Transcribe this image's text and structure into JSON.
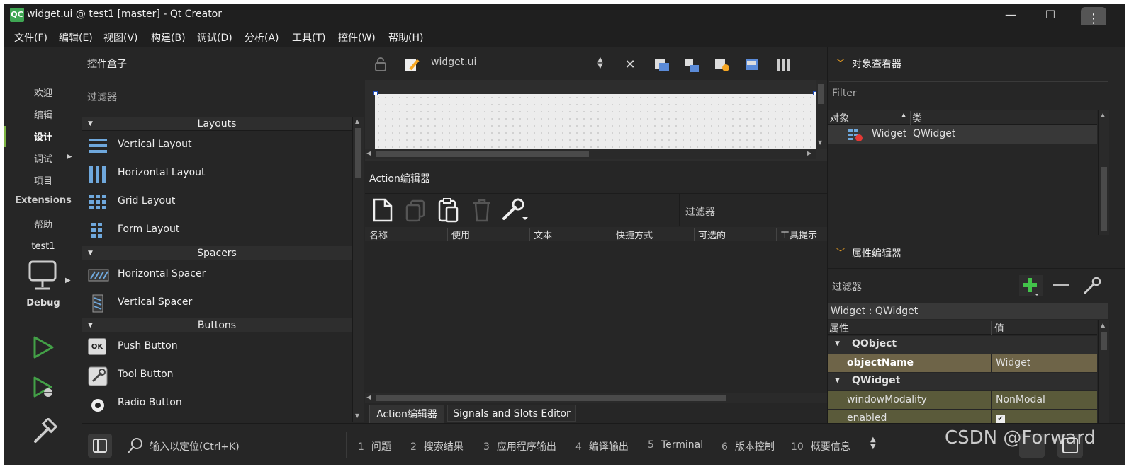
{
  "window": {
    "logo_text": "QC",
    "title": "widget.ui @ test1 [master] - Qt Creator",
    "minimize": "—",
    "maximize": "☐",
    "close": "✕",
    "more": "⋮"
  },
  "menubar": [
    "文件(F)",
    "编辑(E)",
    "视图(V)",
    "构建(B)",
    "调试(D)",
    "分析(A)",
    "工具(T)",
    "控件(W)",
    "帮助(H)"
  ],
  "modes": {
    "items": [
      "欢迎",
      "编辑",
      "设计",
      "调试",
      "项目",
      "Extensions",
      "帮助"
    ],
    "active": "设计",
    "project": "test1",
    "build_config": "Debug"
  },
  "widget_box": {
    "title": "控件盒子",
    "filter_placeholder": "过滤器",
    "categories": [
      {
        "name": "Layouts",
        "items": [
          "Vertical Layout",
          "Horizontal Layout",
          "Grid Layout",
          "Form Layout"
        ]
      },
      {
        "name": "Spacers",
        "items": [
          "Horizontal Spacer",
          "Vertical Spacer"
        ]
      },
      {
        "name": "Buttons",
        "items": [
          "Push Button",
          "Tool Button",
          "Radio Button"
        ]
      }
    ],
    "push_button_icon_text": "OK"
  },
  "editor": {
    "file_name": "widget.ui"
  },
  "action_editor": {
    "title": "Action编辑器",
    "filter_placeholder": "过滤器",
    "columns": [
      "名称",
      "使用",
      "文本",
      "快捷方式",
      "可选的",
      "工具提示"
    ],
    "tabs": [
      "Action编辑器",
      "Signals and Slots Editor"
    ]
  },
  "object_inspector": {
    "title": "对象查看器",
    "filter_placeholder": "Filter",
    "columns": [
      "对象",
      "类"
    ],
    "rows": [
      {
        "object": "Widget",
        "class": "QWidget"
      }
    ]
  },
  "property_editor": {
    "title": "属性编辑器",
    "filter_placeholder": "过滤器",
    "context": "Widget : QWidget",
    "columns": [
      "属性",
      "值"
    ],
    "groups": [
      "QObject",
      "QWidget"
    ],
    "rows": [
      {
        "name": "objectName",
        "value": "Widget"
      },
      {
        "name": "windowModality",
        "value": "NonModal"
      },
      {
        "name": "enabled",
        "value": "✔"
      }
    ]
  },
  "statusbar": {
    "locator_placeholder": "输入以定位(Ctrl+K)",
    "output_tabs": [
      {
        "num": "1",
        "label": "问题"
      },
      {
        "num": "2",
        "label": "搜索结果"
      },
      {
        "num": "3",
        "label": "应用程序输出"
      },
      {
        "num": "4",
        "label": "编译输出"
      },
      {
        "num": "5",
        "label": "Terminal"
      },
      {
        "num": "6",
        "label": "版本控制"
      },
      {
        "num": "10",
        "label": "概要信息"
      }
    ]
  },
  "watermark": "CSDN @Forward",
  "colors": {
    "accent": "#7cb342",
    "logo": "#3fa653",
    "prop_modified": "#6e6448",
    "prop_inherited": "#5a5a3a"
  }
}
